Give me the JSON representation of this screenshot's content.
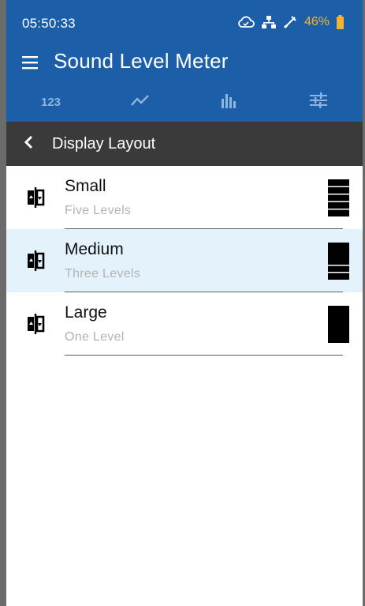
{
  "status_bar": {
    "time": "05:50:33",
    "battery_percent": "46%",
    "battery_color": "#f2b431",
    "icons": [
      "cloud-sync-icon",
      "network-icon",
      "calibration-icon",
      "battery-icon"
    ]
  },
  "app_bar": {
    "title": "Sound Level Meter",
    "menu_icon": "menu-icon",
    "background": "#1c5fa8"
  },
  "tabs": [
    {
      "label": "123",
      "icon": "numeric-tab"
    },
    {
      "label": "",
      "icon": "line-chart-icon"
    },
    {
      "label": "",
      "icon": "bar-chart-icon"
    },
    {
      "label": "",
      "icon": "sliders-icon"
    }
  ],
  "sub_header": {
    "title": "Display Layout",
    "back_icon": "back-icon"
  },
  "layouts": [
    {
      "title": "Small",
      "subtitle": "Five Levels",
      "levels": 5,
      "selected": false
    },
    {
      "title": "Medium",
      "subtitle": "Three Levels",
      "levels": 3,
      "selected": true
    },
    {
      "title": "Large",
      "subtitle": "One Level",
      "levels": 1,
      "selected": false
    }
  ],
  "colors": {
    "selected_row": "#e3f2fb",
    "sub_header": "#3a3a3a"
  }
}
